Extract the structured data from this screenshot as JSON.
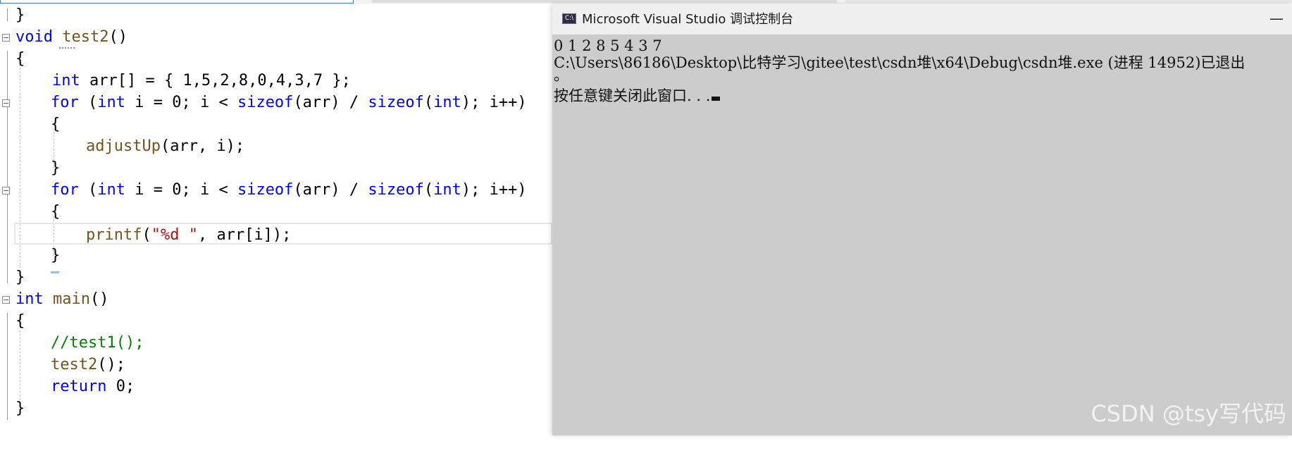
{
  "editor": {
    "lines": {
      "l1": {
        "t0": "}"
      },
      "l2": {
        "t0": "void",
        "t1": " ",
        "t2": "test2",
        "t3": "()"
      },
      "l3": {
        "t0": "{"
      },
      "l4": {
        "t0": "int",
        "t1": " arr[] = { 1,5,2,8,0,4,3,7 };"
      },
      "l5": {
        "t0": "for",
        "t1": " (",
        "t2": "int",
        "t3": " i = 0; i < ",
        "t4": "sizeof",
        "t5": "(arr) / ",
        "t6": "sizeof",
        "t7": "(",
        "t8": "int",
        "t9": "); i++)"
      },
      "l6": {
        "t0": "{"
      },
      "l7": {
        "t0": "adjustUp",
        "t1": "(arr, i);"
      },
      "l8": {
        "t0": "}"
      },
      "l9": {
        "t0": "for",
        "t1": " (",
        "t2": "int",
        "t3": " i = 0; i < ",
        "t4": "sizeof",
        "t5": "(arr) / ",
        "t6": "sizeof",
        "t7": "(",
        "t8": "int",
        "t9": "); i++)"
      },
      "l10": {
        "t0": "{"
      },
      "l11": {
        "t0": "printf",
        "t1": "(",
        "t2": "\"%d \"",
        "t3": ", arr[i]);"
      },
      "l12": {
        "t0": "}"
      },
      "l13": {
        "t0": "}"
      },
      "l14": {
        "t0": "int",
        "t1": " ",
        "t2": "main",
        "t3": "()"
      },
      "l15": {
        "t0": "{"
      },
      "l16": {
        "t0": "//test1();"
      },
      "l17": {
        "t0": "test2",
        "t1": "();"
      },
      "l18": {
        "t0": "return",
        "t1": " 0;"
      },
      "l19": {
        "t0": "}"
      }
    },
    "fold_symbol": "−"
  },
  "console": {
    "icon_text": "C:\\",
    "title": "Microsoft Visual Studio 调试控制台",
    "minimize": "—",
    "output_line1": "0 1 2 8 5 4 3 7",
    "output_line2": "C:\\Users\\86186\\Desktop\\比特学习\\gitee\\test\\csdn堆\\x64\\Debug\\csdn堆.exe (进程 14952)已退出",
    "output_line3": "。",
    "output_line4": "按任意键关闭此窗口. . ."
  },
  "watermark": "CSDN @tsy写代码",
  "colors": {
    "keyword": "#0000ff",
    "function": "#74531f",
    "string": "#a31515",
    "comment": "#008000",
    "console_bg": "#cccccc"
  }
}
